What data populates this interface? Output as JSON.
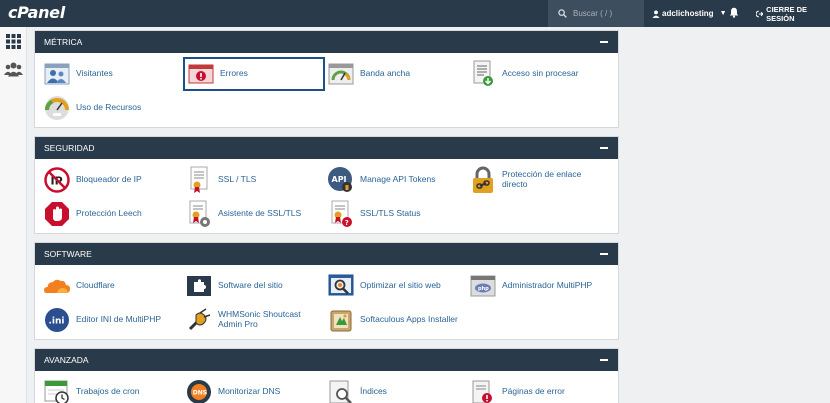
{
  "header": {
    "logo": "cPanel",
    "search_placeholder": "Buscar ( / )",
    "username": "adclichosting",
    "logout_label": "CIERRE DE SESIÓN"
  },
  "sections": {
    "metrica": {
      "title": "MÉTRICA",
      "items": [
        "Visitantes",
        "Errores",
        "Banda ancha",
        "Acceso sin procesar",
        "Uso de Recursos"
      ]
    },
    "seguridad": {
      "title": "SEGURIDAD",
      "items": [
        "Bloqueador de IP",
        "SSL / TLS",
        "Manage API Tokens",
        "Protección de enlace directo",
        "Protección Leech",
        "Asistente de SSL/TLS",
        "SSL/TLS Status"
      ]
    },
    "software": {
      "title": "SOFTWARE",
      "items": [
        "Cloudflare",
        "Software del sitio",
        "Optimizar el sitio web",
        "Administrador MultiPHP",
        "Editor INI de MultiPHP",
        "WHMSonic Shoutcast Admin Pro",
        "Softaculous Apps Installer"
      ]
    },
    "avanzada": {
      "title": "AVANZADA",
      "items": [
        "Trabajos de cron",
        "Monitorizar DNS",
        "Índices",
        "Páginas de error"
      ]
    }
  },
  "colors": {
    "header_bg": "#293a4a",
    "link": "#2a6496",
    "highlight_border": "#1d4f8b"
  }
}
